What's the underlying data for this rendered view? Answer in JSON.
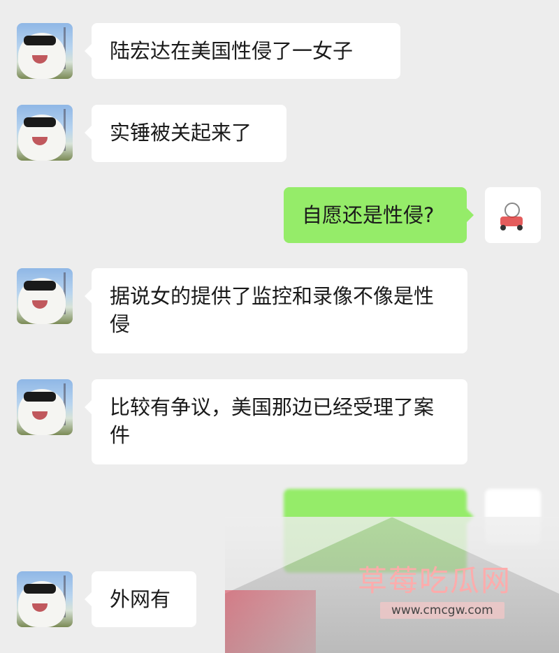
{
  "messages": [
    {
      "side": "in",
      "text": "陆宏达在美国性侵了一女子"
    },
    {
      "side": "in",
      "text": "实锤被关起来了"
    },
    {
      "side": "out",
      "text": "自愿还是性侵?"
    },
    {
      "side": "in",
      "text": "据说女的提供了监控和录像不像是性侵"
    },
    {
      "side": "in",
      "text": "比较有争议，美国那边已经受理了案件"
    },
    {
      "side": "out",
      "text": ""
    },
    {
      "side": "in",
      "text": "外网有"
    }
  ],
  "watermark": {
    "title": "草莓吃瓜网",
    "url": "www.cmcgw.com"
  },
  "colors": {
    "background": "#EDEDED",
    "incoming_bubble": "#FFFFFF",
    "outgoing_bubble": "#95EC69"
  },
  "icons": {
    "contact_avatar": "dog-with-sunglasses-avatar",
    "self_avatar": "cartoon-rider-avatar"
  }
}
